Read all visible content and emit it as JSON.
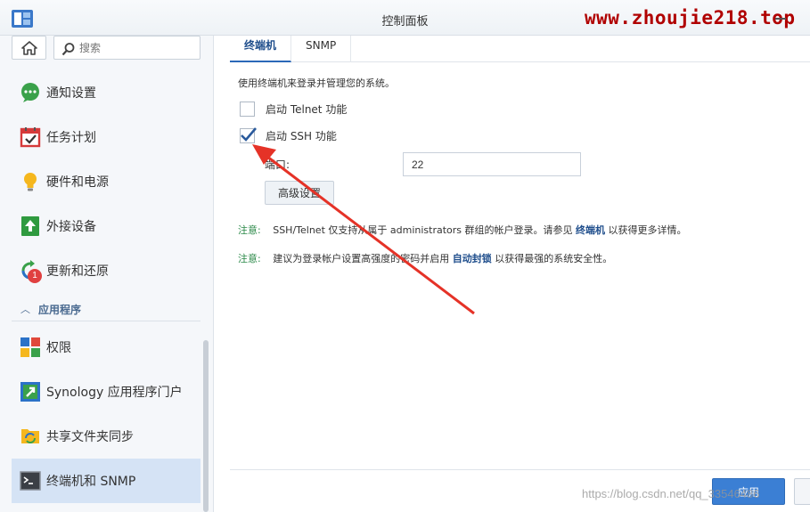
{
  "window": {
    "title": "控制面板",
    "watermark_top": "www.zhoujie218.top",
    "watermark_bottom": "https://blog.csdn.net/qq_33546486"
  },
  "sidebar": {
    "search_placeholder": "搜索",
    "items": [
      {
        "label": "通知设置",
        "icon": "chat-bubble-icon"
      },
      {
        "label": "任务计划",
        "icon": "calendar-check-icon"
      },
      {
        "label": "硬件和电源",
        "icon": "lightbulb-icon"
      },
      {
        "label": "外接设备",
        "icon": "upload-device-icon"
      },
      {
        "label": "更新和还原",
        "icon": "refresh-icon",
        "badge": "1"
      }
    ],
    "section": "应用程序",
    "app_items": [
      {
        "label": "权限",
        "icon": "grid-icon"
      },
      {
        "label": "Synology 应用程序门户",
        "icon": "portal-arrow-icon"
      },
      {
        "label": "共享文件夹同步",
        "icon": "folder-sync-icon"
      },
      {
        "label": "终端机和 SNMP",
        "icon": "terminal-icon",
        "active": true
      }
    ]
  },
  "main": {
    "tabs": [
      {
        "label": "终端机",
        "active": true
      },
      {
        "label": "SNMP",
        "active": false
      }
    ],
    "description": "使用终端机来登录并管理您的系统。",
    "telnet_label": "启动 Telnet 功能",
    "telnet_checked": false,
    "ssh_label": "启动 SSH 功能",
    "ssh_checked": true,
    "port_label": "端口:",
    "port_value": "22",
    "advanced_button": "高级设置",
    "note1": {
      "label": "注意:",
      "text_before": "SSH/Telnet 仅支持从属于 administrators 群组的帐户登录。请参见",
      "link": "终端机",
      "text_after": "以获得更多详情。"
    },
    "note2": {
      "label": "注意:",
      "text_before": "建议为登录帐户设置高强度的密码并启用",
      "link": "自动封锁",
      "text_after": "以获得最强的系统安全性。"
    },
    "apply_button": "应用"
  },
  "colors": {
    "accent": "#3b7fd4",
    "annotation_arrow": "#e53227",
    "note_label": "#2c8a4a",
    "active_nav": "#d5e3f5"
  }
}
